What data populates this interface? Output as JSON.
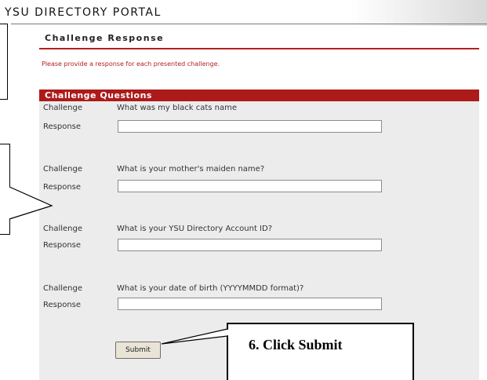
{
  "header": {
    "title": "YSU DIRECTORY PORTAL"
  },
  "section": {
    "title": "Challenge Response",
    "instruction": "Please provide a response for each presented challenge."
  },
  "panel": {
    "header": "Challenge Questions"
  },
  "items": [
    {
      "challenge_label": "Challenge",
      "question": "What was my black cats name",
      "response_label": "Response",
      "value": ""
    },
    {
      "challenge_label": "Challenge",
      "question": "What is your mother's maiden name?",
      "response_label": "Response",
      "value": ""
    },
    {
      "challenge_label": "Challenge",
      "question": "What is your YSU Directory Account ID?",
      "response_label": "Response",
      "value": ""
    },
    {
      "challenge_label": "Challenge",
      "question": "What is your date of birth (YYYYMMDD format)?",
      "response_label": "Response",
      "value": ""
    }
  ],
  "submit": {
    "label": "Submit"
  },
  "annotation": {
    "text": "6.  Click Submit"
  },
  "colors": {
    "accent": "#ad1a1a",
    "panel_bg": "#ececec"
  }
}
